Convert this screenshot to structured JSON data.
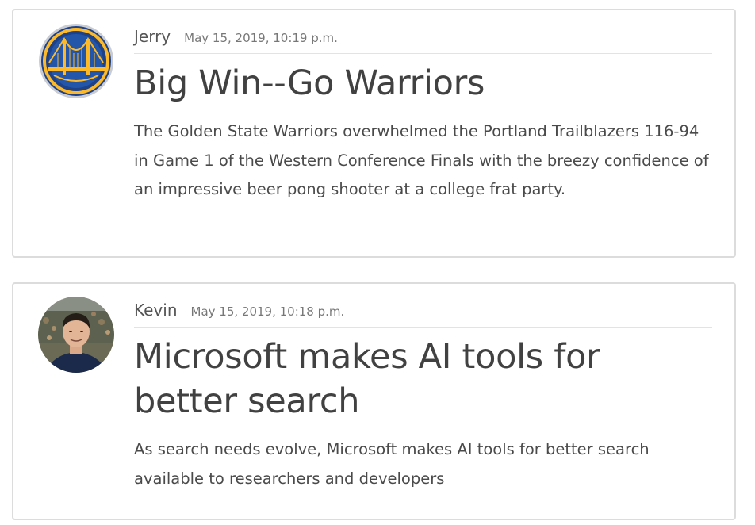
{
  "posts": [
    {
      "author": "Jerry",
      "date": "May 15, 2019, 10:19 p.m.",
      "title": "Big Win--Go Warriors",
      "excerpt": "The Golden State Warriors overwhelmed the Portland Trailblazers 116-94 in Game 1 of the Western Conference Finals with the breezy confidence of an impressive beer pong shooter at a college frat party.",
      "avatar_icon": "warriors-logo-icon"
    },
    {
      "author": "Kevin",
      "date": "May 15, 2019, 10:18 p.m.",
      "title": "Microsoft makes AI tools for better search",
      "excerpt": "As search needs evolve, Microsoft makes AI tools for better search available to researchers and developers",
      "avatar_icon": "user-photo-icon"
    }
  ],
  "colors": {
    "warriors_blue": "#1D428A",
    "warriors_gold": "#FDB927",
    "card_border": "#dcdcdc",
    "text": "#444444"
  }
}
